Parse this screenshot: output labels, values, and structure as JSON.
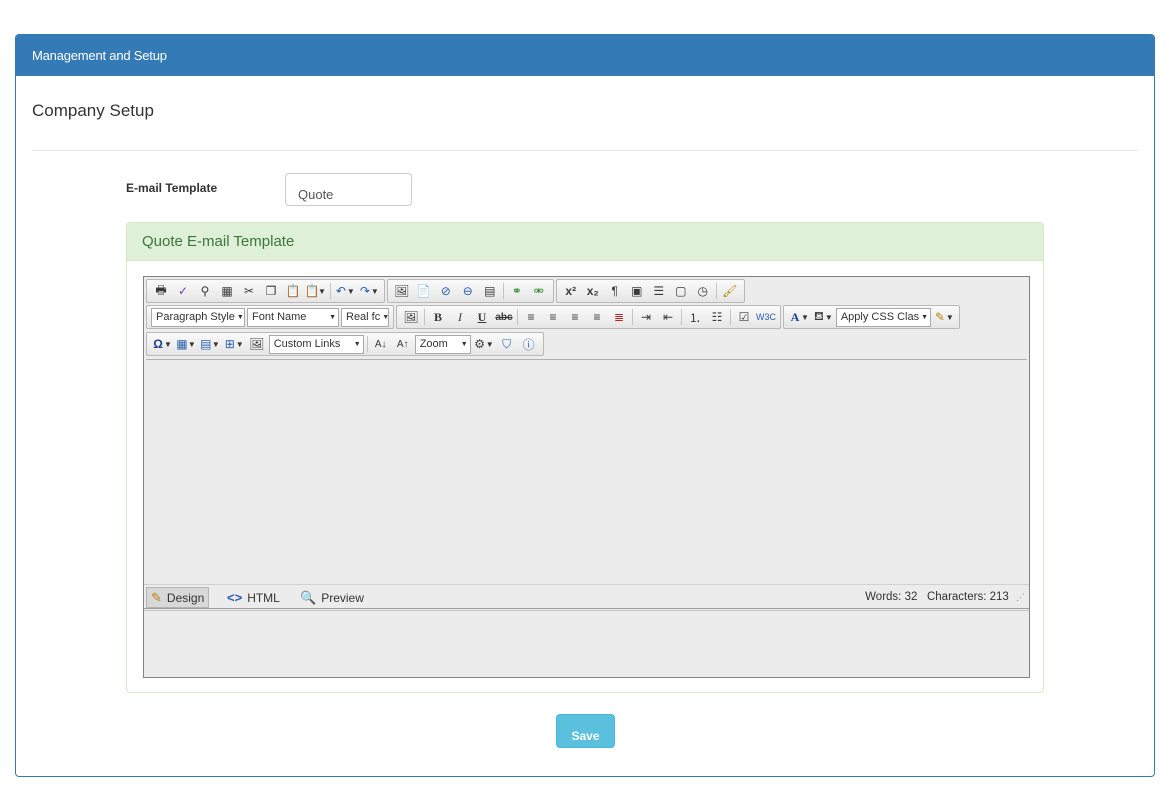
{
  "header": {
    "title": "Management and Setup"
  },
  "page": {
    "title": "Company Setup"
  },
  "form": {
    "email_template_label": "E-mail Template",
    "email_template_value": "Quote"
  },
  "template_panel": {
    "title": "Quote E-mail Template"
  },
  "editor": {
    "toolbar": {
      "paragraph_style": "Paragraph Style",
      "font_name": "Font Name",
      "real_font": "Real fc",
      "apply_css": "Apply CSS Clas",
      "custom_links": "Custom Links",
      "zoom": "Zoom",
      "bold": "B",
      "italic": "I",
      "underline": "U",
      "strike": "abc",
      "font_color": "A"
    },
    "modes": {
      "design": "Design",
      "html": "HTML",
      "preview": "Preview"
    },
    "stats": {
      "words_label": "Words:",
      "words": "32",
      "chars_label": "Characters:",
      "chars": "213"
    }
  },
  "actions": {
    "save": "Save"
  },
  "colors": {
    "primary": "#337ab7",
    "success_bg": "#dff0d8",
    "success_text": "#3c763d",
    "info": "#5bc0de"
  }
}
